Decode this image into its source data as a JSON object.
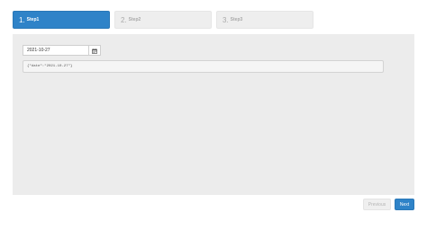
{
  "wizard": {
    "steps": [
      {
        "number": "1.",
        "label": "Step1",
        "active": true
      },
      {
        "number": "2.",
        "label": "Step2",
        "active": false
      },
      {
        "number": "3.",
        "label": "Step3",
        "active": false
      }
    ]
  },
  "form": {
    "date_value": "2021-10-27",
    "calendar_icon": "calendar-icon",
    "json_output": "{\"date\":\"2021-10-27\"}"
  },
  "footer": {
    "previous_label": "Previous",
    "next_label": "Next"
  },
  "colors": {
    "accent": "#2f83c8",
    "inactive_step": "#eeeeee",
    "panel": "#ececec"
  }
}
